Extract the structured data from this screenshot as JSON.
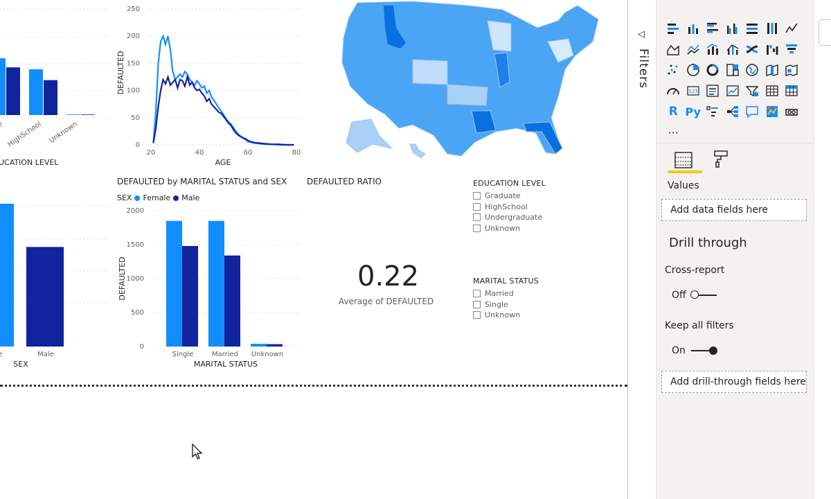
{
  "colors": {
    "female": "#118dff",
    "male": "#12239e",
    "accent": "#f2c811"
  },
  "education_chart": {
    "xlabel": "UCATION LEVEL",
    "categories": [
      "e",
      "HighSchool",
      "Unknown"
    ]
  },
  "age_chart": {
    "xlabel": "AGE",
    "ylabel": "DEFAULTED"
  },
  "marital_chart": {
    "title": "DEFAULTED by MARITAL STATUS and SEX",
    "legend_title": "SEX",
    "legend_female": "Female",
    "legend_male": "Male",
    "xlabel": "MARITAL STATUS",
    "ylabel": "DEFAULTED"
  },
  "sex_chart": {
    "xlabel": "SEX",
    "categories": [
      "ale",
      "Male"
    ]
  },
  "ratio_card": {
    "title": "DEFAULTED RATIO",
    "value": "0.22",
    "label": "Average of DEFAULTED"
  },
  "education_slicer": {
    "title": "EDUCATION LEVEL",
    "items": [
      "Graduate",
      "HighSchool",
      "Undergraduate",
      "Unknown"
    ]
  },
  "marital_slicer": {
    "title": "MARITAL STATUS",
    "items": [
      "Married",
      "Single",
      "Unknown"
    ]
  },
  "filters_pane": {
    "label": "Filters"
  },
  "viz_pane": {
    "icons": [
      "stacked-bar-icon",
      "stacked-column-icon",
      "clustered-bar-icon",
      "clustered-column-icon",
      "100-bar-icon",
      "100-column-icon",
      "line-chart-icon",
      "area-chart-icon",
      "stacked-area-icon",
      "line-column-icon",
      "line-clustered-column-icon",
      "ribbon-chart-icon",
      "waterfall-icon",
      "funnel-icon",
      "scatter-icon",
      "pie-chart-icon",
      "donut-chart-icon",
      "treemap-icon",
      "map-icon",
      "filled-map-icon",
      "shape-map-icon",
      "gauge-icon",
      "card-icon",
      "multirow-card-icon",
      "kpi-icon",
      "slicer-icon",
      "table-icon",
      "matrix-icon",
      "r-visual-icon",
      "python-visual-icon",
      "key-influencers-icon",
      "decomposition-tree-icon",
      "qa-icon",
      "arcgis-map-icon",
      "paginated-report-icon",
      "more-icon"
    ],
    "r_label": "R",
    "py_label": "Py",
    "more_label": "···",
    "values_label": "Values",
    "values_well": "Add data fields here",
    "drill_title": "Drill through",
    "cross_report_label": "Cross-report",
    "cross_report_state": "Off",
    "keep_filters_label": "Keep all filters",
    "keep_filters_state": "On",
    "drill_well": "Add drill-through fields here"
  },
  "chart_data": [
    {
      "type": "bar",
      "x_label": "UCATION LEVEL",
      "categories": [
        "",
        "HighSchool",
        "Unknown"
      ],
      "series": [
        {
          "name": "Female",
          "values": [
            2050,
            1650,
            20
          ]
        },
        {
          "name": "Male",
          "values": [
            1720,
            1260,
            20
          ]
        }
      ]
    },
    {
      "type": "line",
      "x_label": "AGE",
      "y_label": "DEFAULTED",
      "xlim": [
        20,
        80
      ],
      "ylim": [
        0,
        250
      ],
      "x_ticks": [
        20,
        40,
        60,
        80
      ],
      "y_ticks": [
        0,
        50,
        100,
        150,
        200,
        250
      ],
      "series": [
        {
          "name": "Female",
          "x": [
            21,
            22,
            23,
            24,
            25,
            26,
            27,
            28,
            29,
            30,
            31,
            32,
            33,
            34,
            35,
            36,
            37,
            38,
            39,
            40,
            41,
            42,
            43,
            44,
            45,
            46,
            47,
            48,
            49,
            50,
            51,
            52,
            53,
            54,
            55,
            56,
            57,
            58,
            59,
            60,
            61,
            62,
            63,
            65,
            67,
            70,
            73,
            76,
            79
          ],
          "y": [
            5,
            60,
            150,
            190,
            200,
            185,
            200,
            175,
            135,
            120,
            125,
            130,
            125,
            135,
            130,
            120,
            115,
            110,
            118,
            112,
            105,
            108,
            95,
            100,
            88,
            82,
            75,
            68,
            62,
            55,
            48,
            42,
            38,
            32,
            25,
            20,
            16,
            12,
            10,
            6,
            5,
            4,
            3,
            2,
            1,
            1,
            0,
            0,
            0
          ]
        },
        {
          "name": "Male",
          "x": [
            21,
            22,
            23,
            24,
            25,
            26,
            27,
            28,
            29,
            30,
            31,
            32,
            33,
            34,
            35,
            36,
            37,
            38,
            39,
            40,
            41,
            42,
            43,
            44,
            45,
            46,
            47,
            48,
            49,
            50,
            51,
            52,
            53,
            54,
            55,
            56,
            57,
            58,
            59,
            60,
            61,
            62,
            63,
            65,
            67,
            70,
            73,
            76,
            79
          ],
          "y": [
            3,
            30,
            70,
            100,
            120,
            112,
            125,
            110,
            115,
            120,
            105,
            120,
            118,
            108,
            125,
            110,
            115,
            105,
            100,
            102,
            95,
            90,
            80,
            85,
            75,
            70,
            65,
            60,
            58,
            52,
            46,
            40,
            36,
            28,
            22,
            18,
            15,
            13,
            11,
            8,
            6,
            5,
            4,
            3,
            2,
            1,
            1,
            0,
            0
          ]
        }
      ]
    },
    {
      "type": "bar",
      "title": "DEFAULTED by MARITAL STATUS and SEX",
      "x_label": "MARITAL STATUS",
      "y_label": "DEFAULTED",
      "categories": [
        "Single",
        "Married",
        "Unknown"
      ],
      "ylim": [
        0,
        2000
      ],
      "y_ticks": [
        0,
        500,
        1000,
        1500,
        2000
      ],
      "series": [
        {
          "name": "Female",
          "values": [
            1850,
            1850,
            40
          ]
        },
        {
          "name": "Male",
          "values": [
            1480,
            1340,
            35
          ]
        }
      ]
    },
    {
      "type": "bar",
      "x_label": "SEX",
      "categories": [
        "ale",
        "Male"
      ],
      "series": [
        {
          "name": "DEFAULTED",
          "values": [
            3700,
            2580
          ]
        }
      ]
    }
  ]
}
